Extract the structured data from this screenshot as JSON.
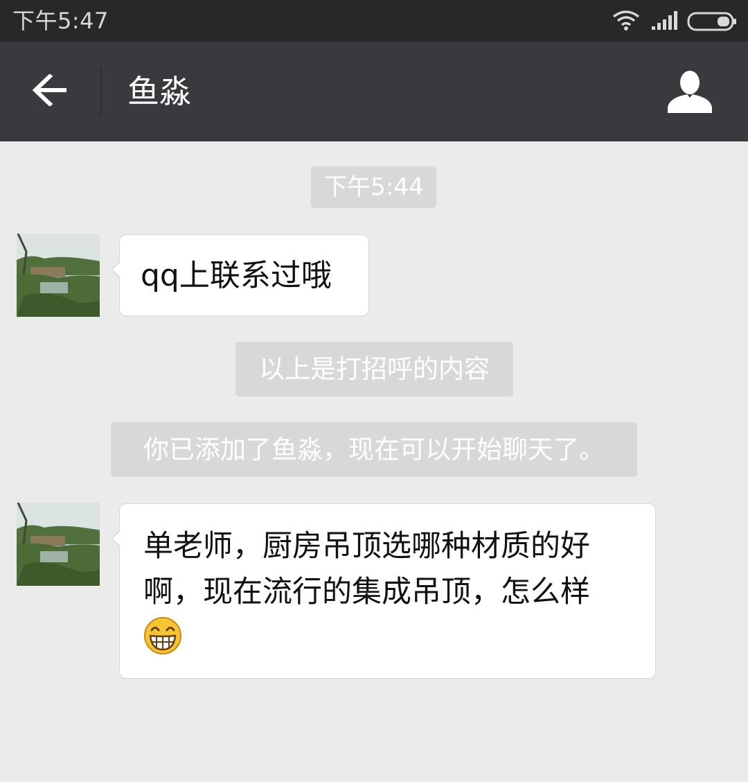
{
  "status_bar": {
    "time": "下午5:47",
    "icons": [
      "wifi-icon",
      "signal-icon",
      "battery-icon"
    ]
  },
  "header": {
    "title": "鱼淼",
    "back_icon": "arrow-left-icon",
    "profile_icon": "person-icon"
  },
  "chat": {
    "timestamp": "下午5:44",
    "messages": [
      {
        "sender": "鱼淼",
        "text": "qq上联系过哦"
      },
      {
        "sender": "鱼淼",
        "text": "单老师，厨房吊顶选哪种材质的好啊，现在流行的集成吊顶，怎么样",
        "emoji": "grinning-face-icon"
      }
    ],
    "notices": [
      "以上是打招呼的内容",
      "你已添加了鱼淼，现在可以开始聊天了。"
    ]
  },
  "colors": {
    "status_bar_bg": "#282829",
    "title_bar_bg": "#393a3e",
    "chat_bg": "#ebebeb",
    "notice_bg": "#d8d8d8",
    "bubble_bg": "#ffffff"
  }
}
